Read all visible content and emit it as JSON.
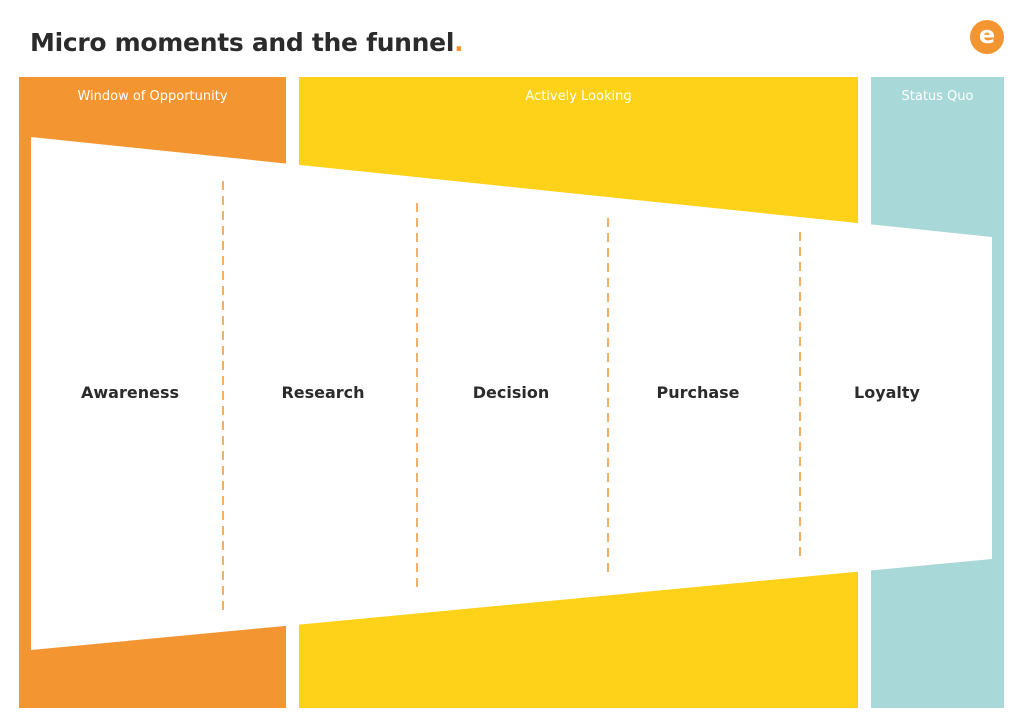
{
  "header": {
    "title": "Micro moments and the funnel",
    "title_suffix": ".",
    "logo_letter": "e"
  },
  "colors": {
    "window_of_opportunity": "#f39530",
    "actively_looking": "#fdd219",
    "status_quo": "#a8d8d8",
    "divider": "#f39530",
    "text": "#2b2b2b"
  },
  "panels": [
    {
      "label": "Window of Opportunity"
    },
    {
      "label": "Actively Looking"
    },
    {
      "label": "Status Quo"
    }
  ],
  "stages": [
    {
      "label": "Awareness"
    },
    {
      "label": "Research"
    },
    {
      "label": "Decision"
    },
    {
      "label": "Purchase"
    },
    {
      "label": "Loyalty"
    }
  ]
}
